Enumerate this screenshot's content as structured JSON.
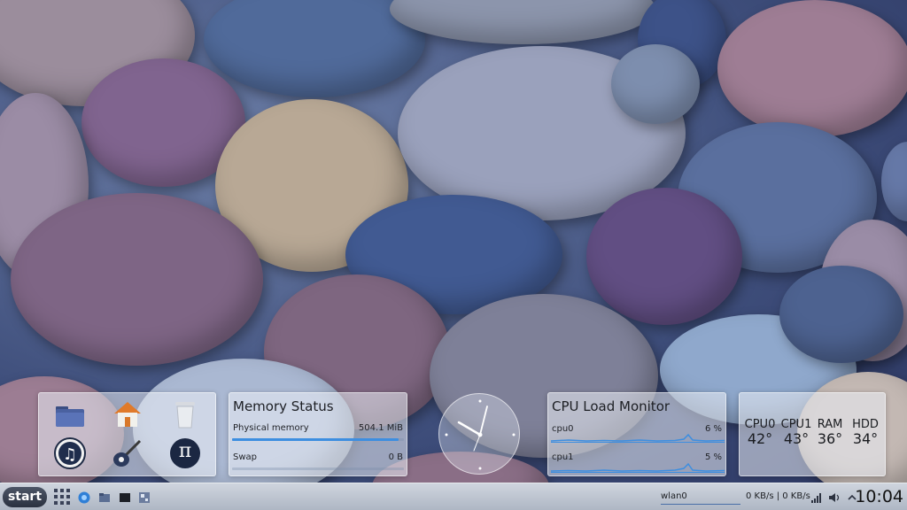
{
  "launcher": {
    "items": [
      {
        "name": "folder-icon"
      },
      {
        "name": "home-icon"
      },
      {
        "name": "trash-icon"
      },
      {
        "name": "music-player-icon"
      },
      {
        "name": "guitar-icon"
      },
      {
        "name": "pi-icon",
        "glyph": "π"
      }
    ]
  },
  "memory": {
    "title": "Memory Status",
    "physical_label": "Physical memory",
    "physical_value": "504.1 MiB",
    "physical_fraction": 0.97,
    "swap_label": "Swap",
    "swap_value": "0 B",
    "swap_fraction": 0
  },
  "cpu": {
    "title": "CPU Load Monitor",
    "cores": [
      {
        "label": "cpu0",
        "value": "6 %"
      },
      {
        "label": "cpu1",
        "value": "5 %"
      }
    ]
  },
  "temps": {
    "items": [
      {
        "name": "CPU0",
        "value": "42°"
      },
      {
        "name": "CPU1",
        "value": "43°"
      },
      {
        "name": "RAM",
        "value": "36°"
      },
      {
        "name": "HDD",
        "value": "34°"
      }
    ]
  },
  "taskbar": {
    "start_label": "start",
    "network_label": "wlan0",
    "network_speed": "0 KB/s | 0 KB/s",
    "time": "10:04"
  },
  "colors": {
    "accent": "#3d8ee0",
    "graph": "#3d8ee0"
  }
}
